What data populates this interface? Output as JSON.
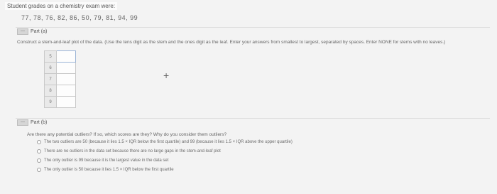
{
  "intro": "Student grades on a chemistry exam were:",
  "scores": "77, 78, 76, 82, 86, 50, 79, 81, 94, 99",
  "part_a": {
    "toggle": "—",
    "label": "Part (a)",
    "instruction": "Construct a stem-and-leaf plot of the data. (Use the tens digit as the stem and the ones digit as the leaf. Enter your answers from smallest to largest, separated by spaces. Enter NONE for stems with no leaves.)",
    "stems": [
      "5",
      "6",
      "7",
      "8",
      "9"
    ],
    "leaves": [
      "",
      "",
      "",
      "",
      ""
    ],
    "add_icon": "+"
  },
  "part_b": {
    "toggle": "—",
    "label": "Part (b)",
    "question": "Are there any potential outliers? If so, which scores are they? Why do you consider them outliers?",
    "options": [
      "The two outliers are 50 (because it lies 1.5 × IQR below the first quartile) and 99 (because it lies 1.5 × IQR above the upper quartile)",
      "There are no outliers in the data set because there are no large gaps in the stem-and-leaf plot",
      "The only outlier is 99 because it is the largest value in the data set",
      "The only outlier is 50 because it lies 1.5 × IQR below the first quartile"
    ]
  }
}
